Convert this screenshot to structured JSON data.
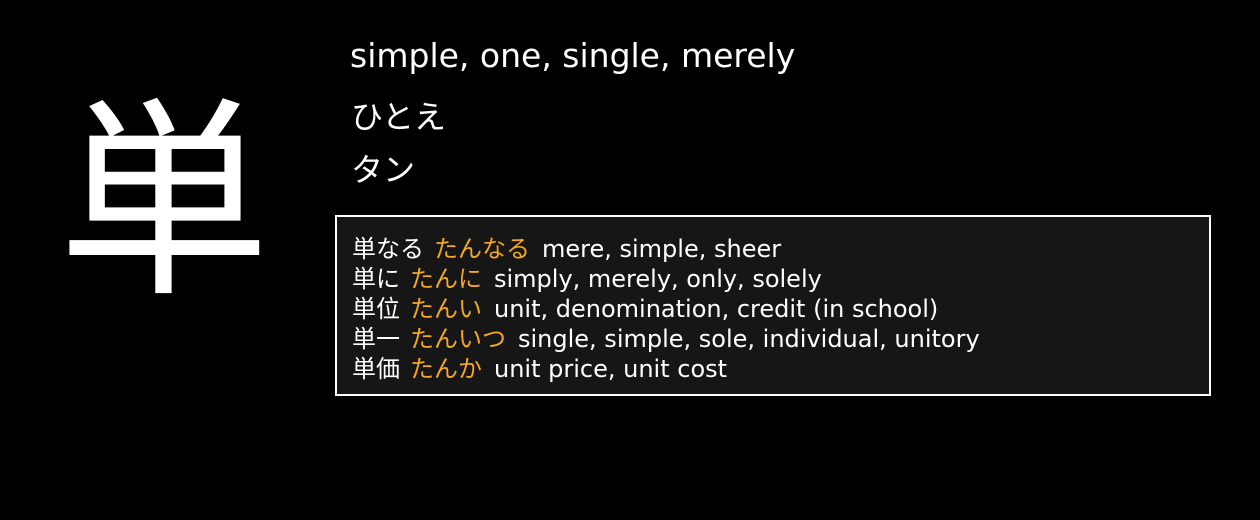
{
  "kanji": "単",
  "meaning": "simple, one, single, merely",
  "kun_reading": "ひとえ",
  "on_reading": "タン",
  "colors": {
    "background": "#000000",
    "text": "#ffffff",
    "reading_accent": "#f5a623",
    "box_background": "#161616",
    "box_border": "#ffffff"
  },
  "vocab": [
    {
      "word": "単なる",
      "reading": "たんなる",
      "gloss": "mere, simple, sheer"
    },
    {
      "word": "単に",
      "reading": "たんに",
      "gloss": "simply, merely, only, solely"
    },
    {
      "word": "単位",
      "reading": "たんい",
      "gloss": "unit, denomination, credit (in school)"
    },
    {
      "word": "単一",
      "reading": "たんいつ",
      "gloss": "single, simple, sole, individual, unitory"
    },
    {
      "word": "単価",
      "reading": "たんか",
      "gloss": "unit price, unit cost"
    }
  ]
}
